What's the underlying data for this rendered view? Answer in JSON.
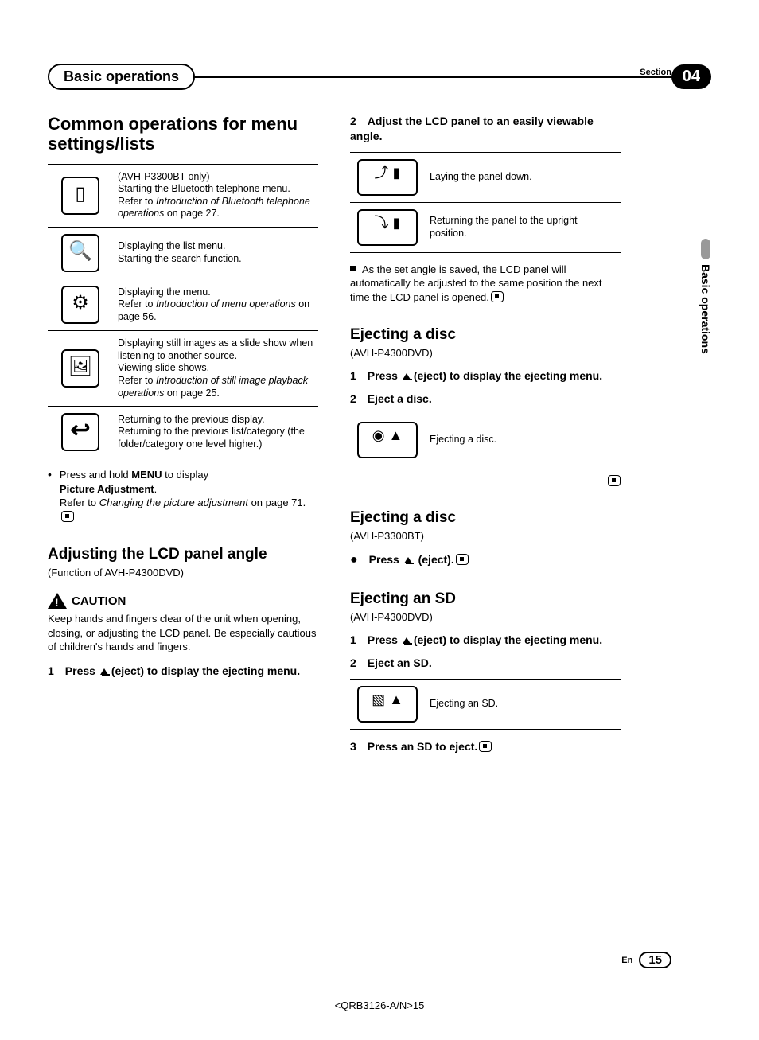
{
  "section_label": "Section",
  "section_number": "04",
  "header_title": "Basic operations",
  "side_tab": "Basic operations",
  "left": {
    "h1": "Common operations for menu settings/lists",
    "rows": [
      {
        "icon": "phone-icon",
        "glyph": "▯",
        "lines": [
          "(AVH-P3300BT only)",
          "Starting the Bluetooth telephone menu.",
          "Refer to ",
          "Introduction of Bluetooth telephone operations",
          " on page 27."
        ]
      },
      {
        "icon": "search-icon",
        "glyph": "🔍",
        "lines": [
          "Displaying the list menu.",
          "Starting the search function."
        ]
      },
      {
        "icon": "menu-icon",
        "glyph": "⚙",
        "lines": [
          "Displaying the menu.",
          "Refer to ",
          "Introduction of menu operations",
          " on page 56."
        ]
      },
      {
        "icon": "slideshow-icon",
        "glyph": "🖼",
        "lines": [
          "Displaying still images as a slide show when listening to another source.",
          "Viewing slide shows.",
          "Refer to ",
          "Introduction of still image playback operations",
          " on page 25."
        ]
      },
      {
        "icon": "return-icon",
        "glyph": "↩",
        "lines": [
          "Returning to the previous display.",
          "Returning to the previous list/category (the folder/category one level higher.)"
        ]
      }
    ],
    "bullet": {
      "line1a": "Press and hold ",
      "menu_word": "MENU",
      "line1b": " to display ",
      "picture_adj": "Picture Adjustment",
      "line2a": "Refer to ",
      "ref": "Changing the picture adjustment",
      "line2b": " on page 71."
    },
    "h2": "Adjusting the LCD panel angle",
    "model": "(Function of AVH-P4300DVD)",
    "caution_label": "CAUTION",
    "caution_text": "Keep hands and fingers clear of the unit when opening, closing, or adjusting the LCD panel. Be especially cautious of children's hands and fingers.",
    "step1_num": "1",
    "step1_a": "Press ",
    "step1_b": "(eject) to display the ejecting menu."
  },
  "right": {
    "step2_num": "2",
    "step2_text": "Adjust the LCD panel to an easily viewable angle.",
    "angle_rows": [
      {
        "glyph": "⤴ ▮",
        "text": "Laying the panel down."
      },
      {
        "glyph": "⤵ ▮",
        "text": "Returning the panel to the upright position."
      }
    ],
    "note": "As the set angle is saved, the LCD panel will automatically be adjusted to the same position the next time the LCD panel is opened.",
    "eject1": {
      "title": "Ejecting a disc",
      "model": "(AVH-P4300DVD)",
      "s1_num": "1",
      "s1_a": "Press ",
      "s1_b": "(eject) to display the ejecting menu.",
      "s2_num": "2",
      "s2_text": "Eject a disc.",
      "row_glyph": "◉ ▲",
      "row_text": "Ejecting a disc."
    },
    "eject2": {
      "title": "Ejecting a disc",
      "model": "(AVH-P3300BT)",
      "bullet_a": "Press ",
      "bullet_b": " (eject)."
    },
    "eject_sd": {
      "title": "Ejecting an SD",
      "model": "(AVH-P4300DVD)",
      "s1_num": "1",
      "s1_a": "Press ",
      "s1_b": "(eject) to display the ejecting menu.",
      "s2_num": "2",
      "s2_text": "Eject an SD.",
      "row_glyph": "▧ ▲",
      "row_text": "Ejecting an SD.",
      "s3_num": "3",
      "s3_text": "Press an SD to eject."
    }
  },
  "footer": {
    "lang": "En",
    "page": "15"
  },
  "doc_code": "<QRB3126-A/N>15",
  "chart_data": null
}
